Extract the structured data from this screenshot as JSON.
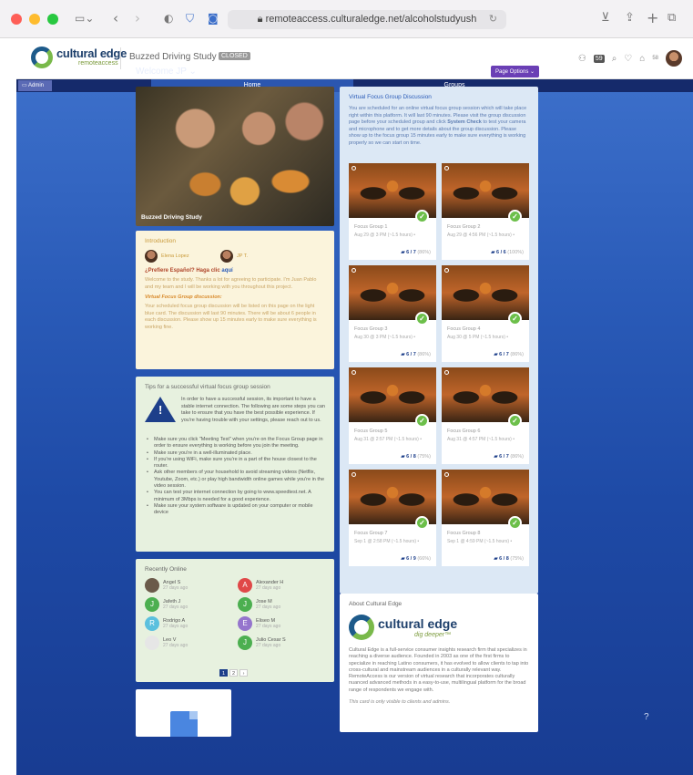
{
  "browser": {
    "url": "remoteaccess.culturaledge.net/alcoholstudyush"
  },
  "header": {
    "logo_main": "cultural edge",
    "logo_sub": "remoteaccess",
    "study_name": "Buzzed Driving Study ⌄",
    "closed_badge": "CLOSED",
    "user_count": "59",
    "notif_count": "58"
  },
  "nav": {
    "admin_label": "Admin",
    "tabs": [
      {
        "label": "Home"
      },
      {
        "label": "Groups"
      }
    ]
  },
  "main": {
    "welcome": "Welcome JP ⌄",
    "page_options": "Page Options ⌄"
  },
  "hero": {
    "caption": "Buzzed Driving Study"
  },
  "intro": {
    "title": "Introduction",
    "person1": "Elena Lopez",
    "person2": "JP T.",
    "spanish_prefix": "¿Prefiere Español? Haga clic ",
    "spanish_link": "aquí",
    "welcome_text": "Welcome to the study. Thanks a lot for agreeing to participate. I'm Juan Pablo and my team and I will be working with you throughout this project.",
    "vfg_heading": "Virtual Focus Group discussion:",
    "vfg_text": "Your scheduled focus group discussion will be listed on this page on the light blue card. The discussion will last 90 minutes. There will be about 6 people in each discussion. Please show up 15 minutes early to make sure everything is working fine."
  },
  "tips": {
    "title": "Tips for a successful virtual focus group session",
    "intro": "In order to have a successful session, its important to have a stable internet connection. The following are some steps you can take to ensure that you have the best possible experience. If you're having trouble with your settings, please reach out to us.",
    "items": [
      "Make sure you click \"Meeting Test\" when you're on the Focus Group page in order to ensure everything is working before you join the meeting.",
      "Make sure you're in a well-illuminated place.",
      "If you're using WiFi, make sure you're in a part of the house closest to the router.",
      "Ask other members of your household to avoid streaming videos (Netflix, Youtube, Zoom, etc.) or play high bandwidth online games while you're in the video session.",
      "You can test your internet connection by going to www.speedtest.net. A minimum of 3Mbps is needed for a good experience.",
      "Make sure your system software is updated on your computer or mobile device"
    ]
  },
  "recent": {
    "title": "Recently Online",
    "users": [
      {
        "name": "Angel S",
        "last": "27 days ago",
        "initial": "",
        "color": "#6b5a4a"
      },
      {
        "name": "Alexander H",
        "last": "27 days ago",
        "initial": "A",
        "color": "#e04848"
      },
      {
        "name": "Jafeth J",
        "last": "27 days ago",
        "initial": "J",
        "color": "#4caf50"
      },
      {
        "name": "Jose M",
        "last": "27 days ago",
        "initial": "J",
        "color": "#4caf50"
      },
      {
        "name": "Rodrigo A",
        "last": "27 days ago",
        "initial": "R",
        "color": "#5bc0de"
      },
      {
        "name": "Eliseo M",
        "last": "27 days ago",
        "initial": "E",
        "color": "#9575cd"
      },
      {
        "name": "Leo V",
        "last": "27 days ago",
        "initial": "",
        "color": "#e6e6e6"
      },
      {
        "name": "Julio Cesar S",
        "last": "27 days ago",
        "initial": "J",
        "color": "#4caf50"
      }
    ],
    "pages": [
      "1",
      "2",
      "›"
    ]
  },
  "vfg": {
    "title": "Virtual Focus Group Discussion",
    "desc_1": "You are scheduled for an online virtual focus group session which will take place right within this platform. It will last 90 minutes. Please visit the group discussion page before your scheduled group and click ",
    "desc_bold": "System Check",
    "desc_2": " to test your camera and microphone and to get more details about the group discussion. Please show up to the focus group 15 minutes early to make sure everything is working properly so we can start on time.",
    "groups": [
      {
        "name": "Focus Group 1",
        "date": "Aug 29 @ 3 PM (~1.5 hours) •",
        "count": "6 / 7",
        "pct": "(86%)"
      },
      {
        "name": "Focus Group 2",
        "date": "Aug 29 @ 4:56 PM (~1.5 hours) •",
        "count": "6 / 6",
        "pct": "(100%)"
      },
      {
        "name": "Focus Group 3",
        "date": "Aug 30 @ 3 PM (~1.5 hours) •",
        "count": "6 / 7",
        "pct": "(86%)"
      },
      {
        "name": "Focus Group 4",
        "date": "Aug 30 @ 5 PM (~1.5 hours) •",
        "count": "6 / 7",
        "pct": "(86%)"
      },
      {
        "name": "Focus Group 5",
        "date": "Aug 31 @ 2:57 PM (~1.5 hours) •",
        "count": "6 / 8",
        "pct": "(75%)"
      },
      {
        "name": "Focus Group 6",
        "date": "Aug 31 @ 4:57 PM (~1.5 hours) •",
        "count": "6 / 7",
        "pct": "(86%)"
      },
      {
        "name": "Focus Group 7",
        "date": "Sep 1 @ 2:58 PM (~1.5 hours) •",
        "count": "6 / 9",
        "pct": "(66%)"
      },
      {
        "name": "Focus Group 8",
        "date": "Sep 1 @ 4:59 PM (~1.5 hours) •",
        "count": "6 / 8",
        "pct": "(75%)"
      }
    ]
  },
  "about": {
    "title": "About Cultural Edge",
    "logo_main": "cultural edge",
    "logo_tag": "dig deeper™",
    "text": "Cultural Edge is a full-service consumer insights research firm that specializes in reaching a diverse audience. Founded in 2003 as one of the first firms to specialize in reaching Latino consumers, it has evolved to allow clients to tap into cross-cultural and mainstream audiences in a culturally relevant way. RemoteAccess is our version of virtual research that incorporates culturally nuanced advanced methods in a easy-to-use, multilingual platform for the broad range of respondents we engage with.",
    "note": "This card is only visible to clients and admins."
  },
  "help": "?"
}
